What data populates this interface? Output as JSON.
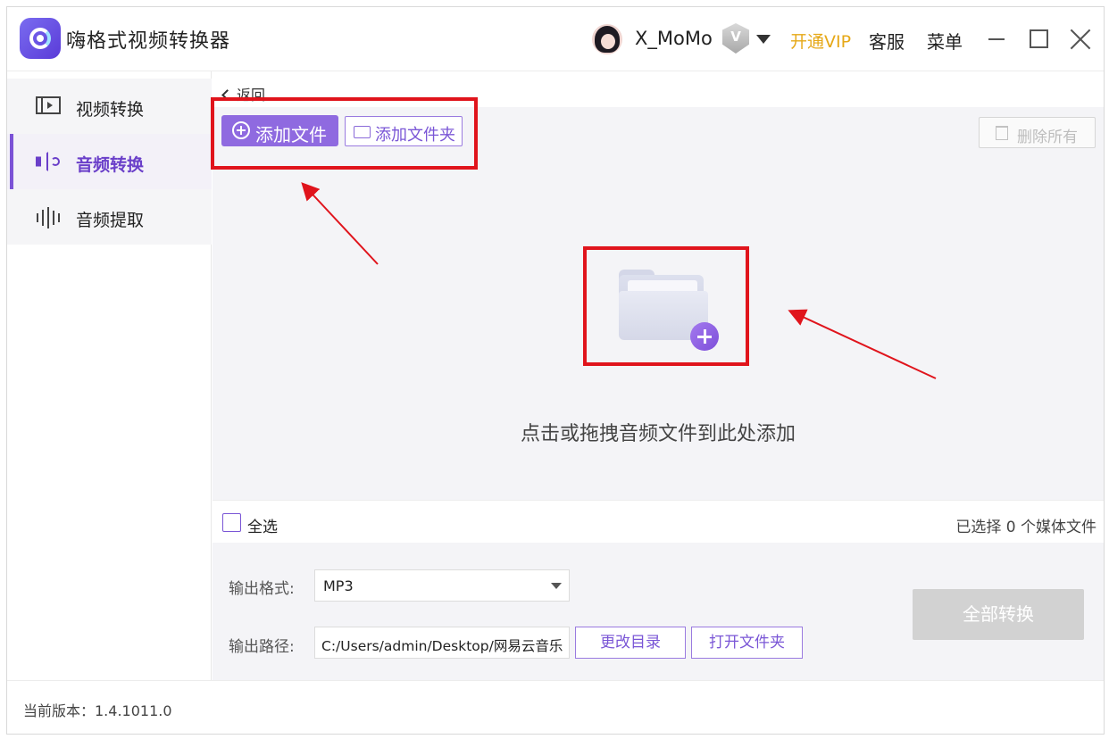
{
  "app": {
    "title": "嗨格式视频转换器"
  },
  "header": {
    "username": "X_MoMo",
    "vip_badge": "V",
    "open_vip": "开通VIP",
    "service": "客服",
    "menu": "菜单"
  },
  "sidebar": {
    "items": [
      {
        "label": "视频转换",
        "icon": "video-convert-icon",
        "active": false
      },
      {
        "label": "音频转换",
        "icon": "audio-convert-icon",
        "active": true
      },
      {
        "label": "音频提取",
        "icon": "audio-extract-icon",
        "active": false
      }
    ]
  },
  "main": {
    "back_label": "返回",
    "toolbar": {
      "add_file": "添加文件",
      "add_folder": "添加文件夹",
      "delete_all": "删除所有"
    },
    "dropzone": {
      "hint": "点击或拖拽音频文件到此处添加"
    },
    "selection": {
      "select_all": "全选",
      "selected_count": "已选择 0 个媒体文件"
    },
    "settings": {
      "format_label": "输出格式:",
      "format_value": "MP3",
      "path_label": "输出路径:",
      "path_value": "C:/Users/admin/Desktop/网易云音乐",
      "change_dir": "更改目录",
      "open_folder": "打开文件夹",
      "convert_all": "全部转换"
    }
  },
  "status": {
    "version": "当前版本：1.4.1011.0"
  },
  "colors": {
    "accent": "#8f6ae0",
    "vip": "#e6a817",
    "annotation": "#e0141c",
    "disabled": "#d2d2d2"
  }
}
